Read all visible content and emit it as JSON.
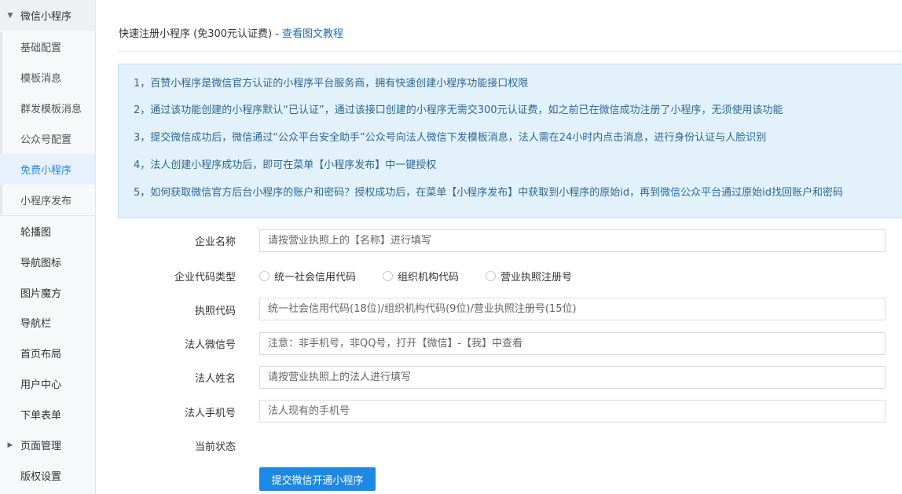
{
  "sidebar": {
    "group_title": "微信小程序",
    "sub_items": [
      "基础配置",
      "模板消息",
      "群发模板消息",
      "公众号配置",
      "免费小程序",
      "小程序发布"
    ],
    "active_index": 4,
    "items": [
      "轮播图",
      "导航图标",
      "图片魔方",
      "导航栏",
      "首页布局",
      "用户中心",
      "下单表单"
    ],
    "page_manage": "页面管理",
    "copyright": "版权设置"
  },
  "header": {
    "title": "快速注册小程序 (免300元认证费) - ",
    "tutorial_link": "查看图文教程"
  },
  "info": {
    "line1": "1，百赞小程序是微信官方认证的小程序平台服务商，拥有快速创建小程序功能接口权限",
    "line2": "2，通过该功能创建的小程序默认“已认证”，通过该接口创建的小程序无需交300元认证费，如之前已在微信成功注册了小程序，无须使用该功能",
    "line3": "3，提交微信成功后，微信通过“公众平台安全助手”公众号向法人微信下发模板消息，法人需在24小时内点击消息，进行身份认证与人脸识别",
    "line4": "4，法人创建小程序成功后，即可在菜单【小程序发布】中一键授权",
    "line5_pre": "5，如何获取微信官方后台小程序的账户和密码？授权成功后，在菜单【小程序发布】中获取到小程序的原始id，再到",
    "line5_link": "微信公众平台",
    "line5_post": "通过原始id找回账户和密码"
  },
  "form": {
    "company_name": {
      "label": "企业名称",
      "placeholder": "请按营业执照上的【名称】进行填写",
      "value": ""
    },
    "code_type": {
      "label": "企业代码类型",
      "options": [
        "统一社会信用代码",
        "组织机构代码",
        "营业执照注册号"
      ]
    },
    "license_code": {
      "label": "执照代码",
      "placeholder": "统一社会信用代码(18位)/组织机构代码(9位)/营业执照注册号(15位)",
      "value": ""
    },
    "legal_wechat": {
      "label": "法人微信号",
      "placeholder": "注意：非手机号，非QQ号，打开【微信】-【我】中查看",
      "value": ""
    },
    "legal_name": {
      "label": "法人姓名",
      "placeholder": "请按营业执照上的法人进行填写",
      "value": ""
    },
    "legal_phone": {
      "label": "法人手机号",
      "placeholder": "法人现有的手机号",
      "value": ""
    },
    "status": {
      "label": "当前状态",
      "value": ""
    },
    "submit_label": "提交微信开通小程序"
  },
  "colors": {
    "accent": "#1e88e5",
    "info_bg": "#e3f1fa",
    "info_text": "#2a6a98",
    "link": "#1e6fb8"
  }
}
